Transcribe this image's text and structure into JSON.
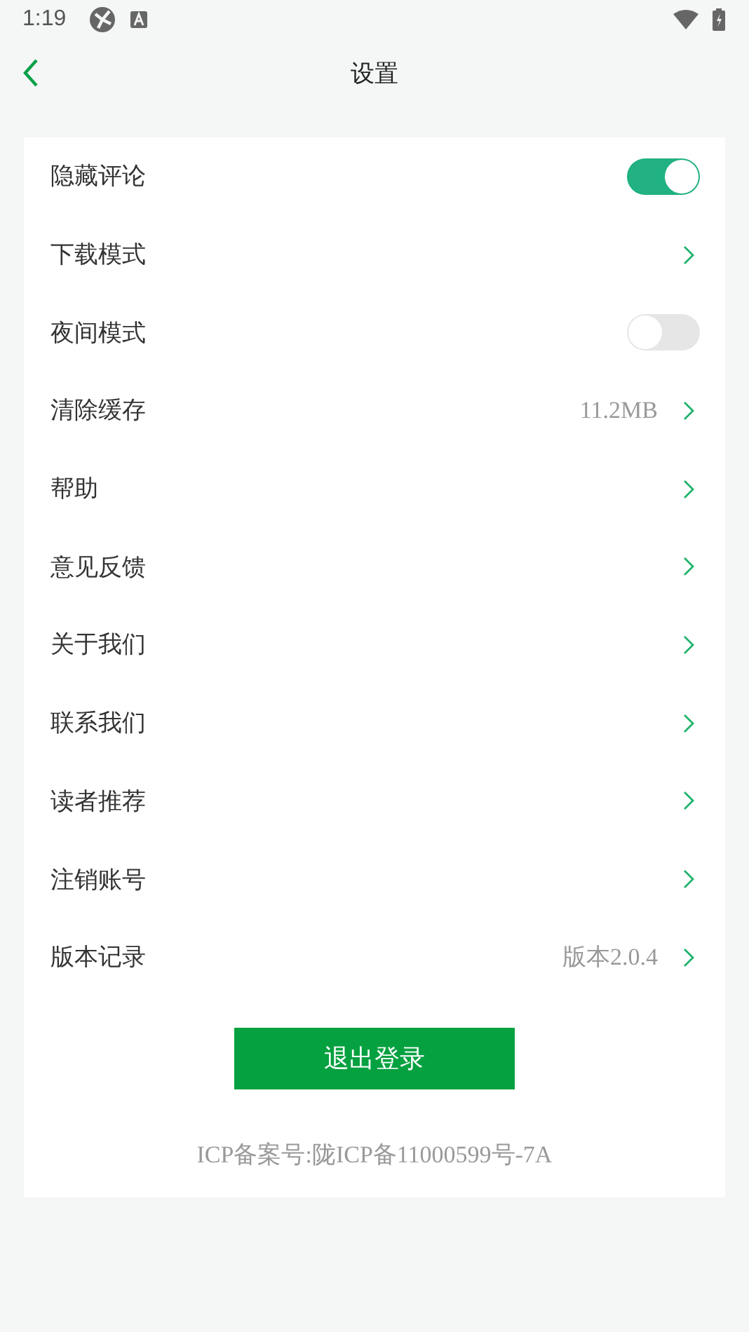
{
  "status_bar": {
    "time": "1:19"
  },
  "header": {
    "title": "设置"
  },
  "settings": [
    {
      "kind": "toggle",
      "label": "隐藏评论",
      "on": true
    },
    {
      "kind": "link",
      "label": "下载模式"
    },
    {
      "kind": "toggle",
      "label": "夜间模式",
      "on": false
    },
    {
      "kind": "link",
      "label": "清除缓存",
      "value": "11.2MB"
    },
    {
      "kind": "link",
      "label": "帮助"
    },
    {
      "kind": "link",
      "label": "意见反馈"
    },
    {
      "kind": "link",
      "label": "关于我们"
    },
    {
      "kind": "link",
      "label": "联系我们"
    },
    {
      "kind": "link",
      "label": "读者推荐"
    },
    {
      "kind": "link",
      "label": "注销账号"
    },
    {
      "kind": "link",
      "label": "版本记录",
      "value": "版本2.0.4"
    }
  ],
  "logout_button": "退出登录",
  "icp": "ICP备案号:陇ICP备11000599号-7A"
}
